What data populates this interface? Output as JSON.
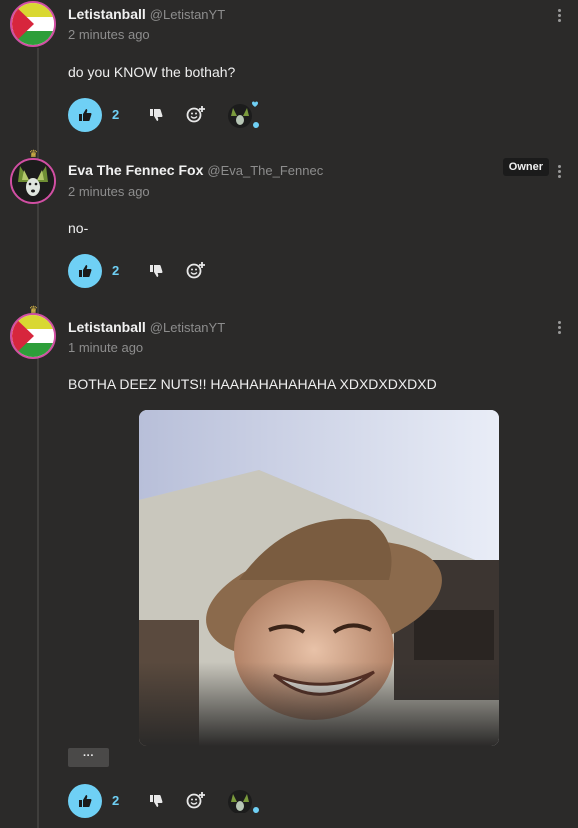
{
  "comments": [
    {
      "name": "Letistanball",
      "handle": "@LetistanYT",
      "time": "2 minutes ago",
      "text": "do you KNOW the bothah?",
      "likes": "2",
      "avatar_icon": "flag-avatar-icon"
    },
    {
      "name": "Eva The Fennec Fox",
      "handle": "@Eva_The_Fennec",
      "time": "2 minutes ago",
      "text": "no-",
      "likes": "2",
      "badge": "Owner",
      "avatar_icon": "fennec-avatar-icon"
    },
    {
      "name": "Letistanball",
      "handle": "@LetistanYT",
      "time": "1 minute ago",
      "text": "BOTHA DEEZ NUTS!! HAAHAHAHAHAHA XDXDXDXDXD",
      "likes": "2",
      "more_label": "···",
      "avatar_icon": "flag-avatar-icon"
    }
  ],
  "colors": {
    "background": "#2b2a29",
    "accent": "#6fd0f5",
    "avatar_border": "#d14fa3"
  }
}
